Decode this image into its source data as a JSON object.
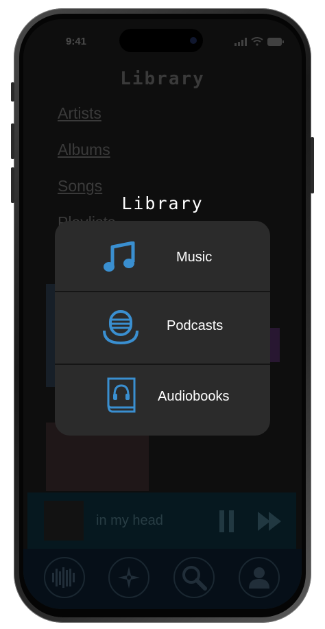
{
  "status": {
    "time": "9:41"
  },
  "library": {
    "title": "Library",
    "links": [
      "Artists",
      "Albums",
      "Songs",
      "Playlists"
    ]
  },
  "mini_player": {
    "track": "in my head"
  },
  "modal": {
    "title": "Library",
    "options": [
      {
        "label": "Music",
        "icon": "music-note-icon"
      },
      {
        "label": "Podcasts",
        "icon": "microphone-icon"
      },
      {
        "label": "Audiobooks",
        "icon": "headphones-book-icon"
      }
    ]
  },
  "tabs": [
    {
      "icon": "audio-bars-icon"
    },
    {
      "icon": "compass-icon"
    },
    {
      "icon": "search-icon"
    },
    {
      "icon": "profile-icon"
    }
  ],
  "colors": {
    "accent": "#3a8fd0",
    "modal_bg": "#2b2b2b"
  }
}
